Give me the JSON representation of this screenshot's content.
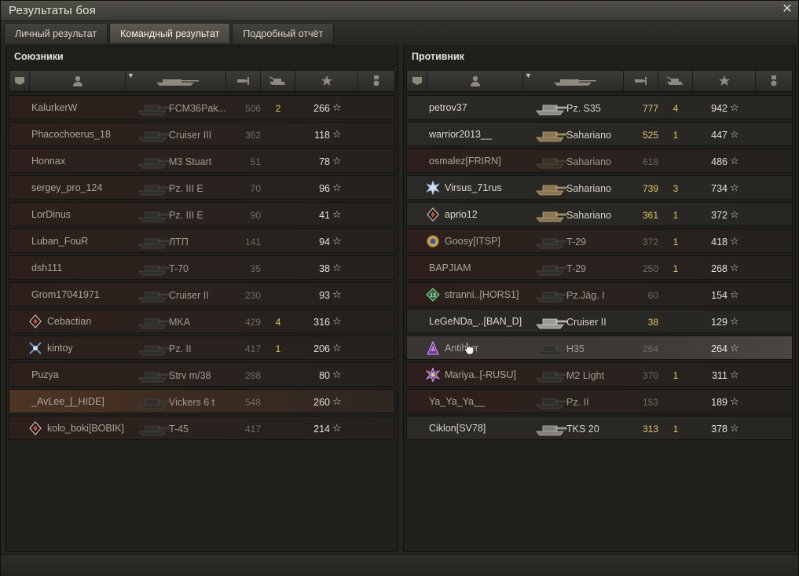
{
  "window": {
    "title": "Результаты боя",
    "close_icon": "close-icon"
  },
  "tabs": [
    {
      "label": "Личный результат",
      "active": false
    },
    {
      "label": "Командный результат",
      "active": true
    },
    {
      "label": "Подробный отчёт",
      "active": false
    }
  ],
  "colors": {
    "accent_gold": "#e8c36a",
    "self_row": "#4e3525"
  },
  "columns": {
    "icons": [
      "vehicle-status-icon",
      "player-icon",
      "tank-type-icon",
      "damage-icon",
      "kills-icon",
      "experience-star-icon",
      "medal-icon"
    ]
  },
  "allies": {
    "title": "Союзники",
    "rows": [
      {
        "player": "KalurkerW",
        "badge": "",
        "tank": "FCM36Pak...",
        "damage": "506",
        "kills": "2",
        "xp": "266",
        "state": "dead"
      },
      {
        "player": "Phacochoerus_18",
        "badge": "",
        "tank": "Cruiser III",
        "damage": "362",
        "kills": "",
        "xp": "118",
        "state": "dead"
      },
      {
        "player": "Honnax",
        "badge": "",
        "tank": "M3 Stuart",
        "damage": "51",
        "kills": "",
        "xp": "78",
        "state": "dead"
      },
      {
        "player": "sergey_pro_124",
        "badge": "",
        "tank": "Pz. III E",
        "damage": "70",
        "kills": "",
        "xp": "96",
        "state": "dead"
      },
      {
        "player": "LorDinus",
        "badge": "",
        "tank": "Pz. III E",
        "damage": "90",
        "kills": "",
        "xp": "41",
        "state": "dead"
      },
      {
        "player": "Luban_FouR",
        "badge": "",
        "tank": "ЛТП",
        "damage": "141",
        "kills": "",
        "xp": "94",
        "state": "dead"
      },
      {
        "player": "dsh111",
        "badge": "",
        "tank": "T-70",
        "damage": "35",
        "kills": "",
        "xp": "38",
        "state": "dead"
      },
      {
        "player": "Grom17041971",
        "badge": "",
        "tank": "Cruiser II",
        "damage": "230",
        "kills": "",
        "xp": "93",
        "state": "dead"
      },
      {
        "player": "Cebactian",
        "badge": "diamond",
        "tank": "MKA",
        "damage": "429",
        "kills": "4",
        "xp": "316",
        "state": "dead"
      },
      {
        "player": "kintoy",
        "badge": "star",
        "tank": "Pz. II",
        "damage": "417",
        "kills": "1",
        "xp": "206",
        "state": "dead"
      },
      {
        "player": "Puzya",
        "badge": "",
        "tank": "Strv m/38",
        "damage": "288",
        "kills": "",
        "xp": "80",
        "state": "dead"
      },
      {
        "player": "_AvLee_[_HIDE]",
        "badge": "",
        "tank": "Vickers 6 t",
        "damage": "548",
        "kills": "",
        "xp": "260",
        "state": "self"
      },
      {
        "player": "kolo_boki[BOBIK]",
        "badge": "diamond",
        "tank": "T-45",
        "damage": "417",
        "kills": "",
        "xp": "214",
        "state": "dead"
      }
    ]
  },
  "enemies": {
    "title": "Противник",
    "rows": [
      {
        "player": "petrov37",
        "badge": "",
        "tank": "Pz. S35",
        "damage": "777",
        "kills": "4",
        "xp": "942",
        "state": "alive"
      },
      {
        "player": "warrior2013__",
        "badge": "",
        "tank": "Sahariano",
        "damage": "525",
        "kills": "1",
        "xp": "447",
        "state": "alive"
      },
      {
        "player": "osmalez[FRIRN]",
        "badge": "",
        "tank": "Sahariano",
        "damage": "618",
        "kills": "",
        "xp": "486",
        "state": "dead"
      },
      {
        "player": "Virsus_71rus",
        "badge": "snow",
        "tank": "Sahariano",
        "damage": "739",
        "kills": "3",
        "xp": "734",
        "state": "alive"
      },
      {
        "player": "aprio12",
        "badge": "diamond",
        "tank": "Sahariano",
        "damage": "361",
        "kills": "1",
        "xp": "372",
        "state": "alive"
      },
      {
        "player": "Goosy[ITSP]",
        "badge": "gear",
        "tank": "T-29",
        "damage": "372",
        "kills": "1",
        "xp": "418",
        "state": "dead"
      },
      {
        "player": "BAPJIAM",
        "badge": "",
        "tank": "T-29",
        "damage": "250",
        "kills": "1",
        "xp": "268",
        "state": "dead"
      },
      {
        "player": "stranni..[HORS1]",
        "badge": "13",
        "tank": "Pz.Jäg. I",
        "damage": "60",
        "kills": "",
        "xp": "154",
        "state": "dead"
      },
      {
        "player": "LeGeNDa_..[BAN_D]",
        "badge": "",
        "tank": "Cruiser II",
        "damage": "38",
        "kills": "",
        "xp": "129",
        "state": "alive"
      },
      {
        "player": "Antihter",
        "badge": "purple",
        "tank": "H35",
        "damage": "264",
        "kills": "",
        "xp": "264",
        "state": "hover"
      },
      {
        "player": "Mariya..[-RUSU]",
        "badge": "purple2",
        "tank": "M2 Light",
        "damage": "370",
        "kills": "1",
        "xp": "311",
        "state": "dead"
      },
      {
        "player": "Ya_Ya_Ya__",
        "badge": "",
        "tank": "Pz. II",
        "damage": "153",
        "kills": "",
        "xp": "189",
        "state": "dead"
      },
      {
        "player": "Ciklon[SV78]",
        "badge": "",
        "tank": "TKS 20",
        "damage": "313",
        "kills": "1",
        "xp": "378",
        "state": "alive"
      }
    ]
  }
}
